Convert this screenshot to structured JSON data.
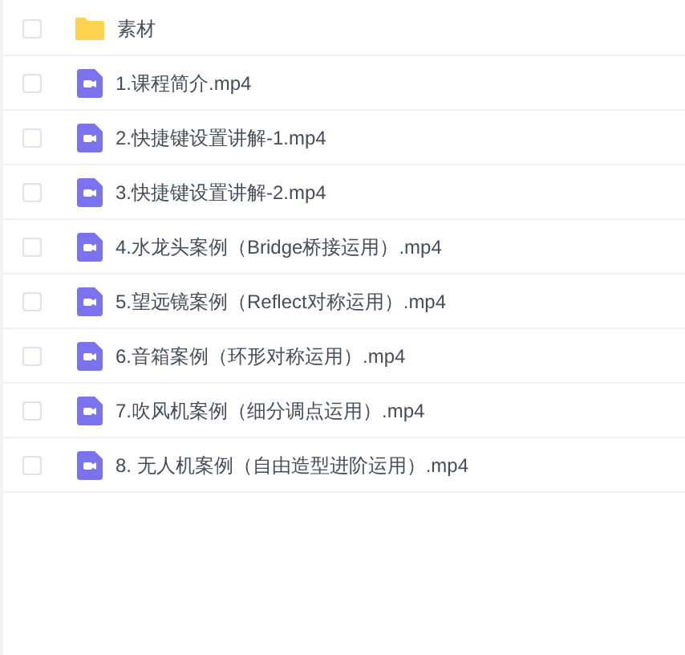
{
  "files": [
    {
      "kind": "folder",
      "name": "素材",
      "checked": false
    },
    {
      "kind": "video",
      "name": "1.课程简介.mp4",
      "checked": false
    },
    {
      "kind": "video",
      "name": "2.快捷键设置讲解-1.mp4",
      "checked": false
    },
    {
      "kind": "video",
      "name": "3.快捷键设置讲解-2.mp4",
      "checked": false
    },
    {
      "kind": "video",
      "name": "4.水龙头案例（Bridge桥接运用）.mp4",
      "checked": false
    },
    {
      "kind": "video",
      "name": "5.望远镜案例（Reflect对称运用）.mp4",
      "checked": false
    },
    {
      "kind": "video",
      "name": "6.音箱案例（环形对称运用）.mp4",
      "checked": false
    },
    {
      "kind": "video",
      "name": "7.吹风机案例（细分调点运用）.mp4",
      "checked": false
    },
    {
      "kind": "video",
      "name": "8. 无人机案例（自由造型进阶运用）.mp4",
      "checked": false
    }
  ]
}
